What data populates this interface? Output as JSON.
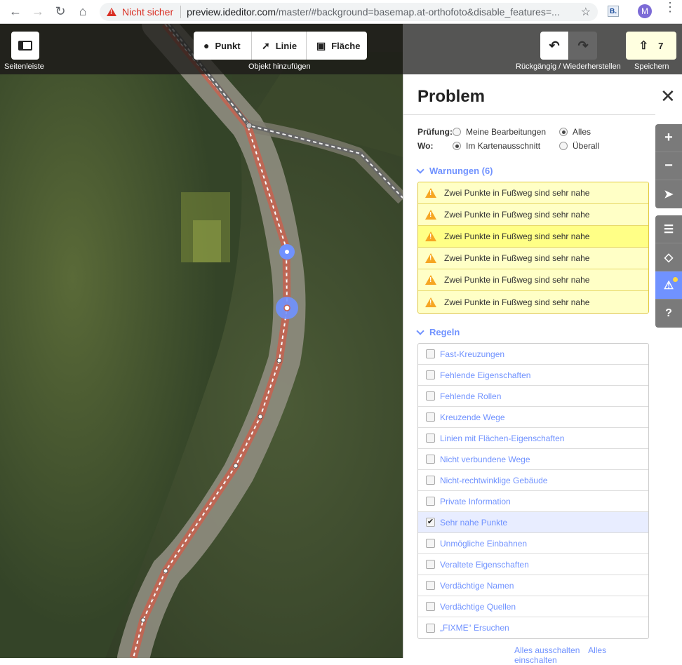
{
  "browser": {
    "insecure_label": "Nicht sicher",
    "url_host": "preview.ideditor.com",
    "url_path": "/master/#background=basemap.at-orthofoto&disable_features=...",
    "extension_label": "B.",
    "profile_initial": "M"
  },
  "toolbar": {
    "sidebar_label": "Seitenleiste",
    "add_point": "Punkt",
    "add_line": "Linie",
    "add_area": "Fläche",
    "add_feature_label": "Objekt hinzufügen",
    "undo_redo_label": "Rückgängig / Wiederherstellen",
    "save_count": "7",
    "save_label": "Speichern"
  },
  "panel": {
    "title": "Problem",
    "check_label": "Prüfung:",
    "check_options": [
      "Meine Bearbeitungen",
      "Alles"
    ],
    "where_label": "Wo:",
    "where_options": [
      "Im Kartenausschnitt",
      "Überall"
    ],
    "warnings_header": "Warnungen (6)",
    "warnings": [
      "Zwei Punkte in Fußweg sind sehr nahe",
      "Zwei Punkte in Fußweg sind sehr nahe",
      "Zwei Punkte in Fußweg sind sehr nahe",
      "Zwei Punkte in Fußweg sind sehr nahe",
      "Zwei Punkte in Fußweg sind sehr nahe",
      "Zwei Punkte in Fußweg sind sehr nahe"
    ],
    "rules_header": "Regeln",
    "rules": [
      "Fast-Kreuzungen",
      "Fehlende Eigenschaften",
      "Fehlende Rollen",
      "Kreuzende Wege",
      "Linien mit Flächen-Eigenschaften",
      "Nicht verbundene Wege",
      "Nicht-rechtwinklige Gebäude",
      "Private Information",
      "Sehr nahe Punkte",
      "Unmögliche Einbahnen",
      "Veraltete Eigenschaften",
      "Verdächtige Namen",
      "Verdächtige Quellen",
      "„FIXME“ Ersuchen"
    ],
    "checked_rule": "Sehr nahe Punkte",
    "deselect_all": "Alles ausschalten",
    "select_all": "Alles einschalten"
  },
  "colors": {
    "accent": "#7092ff",
    "warning_bg": "#ffffc6",
    "path_red": "#c7624f"
  }
}
